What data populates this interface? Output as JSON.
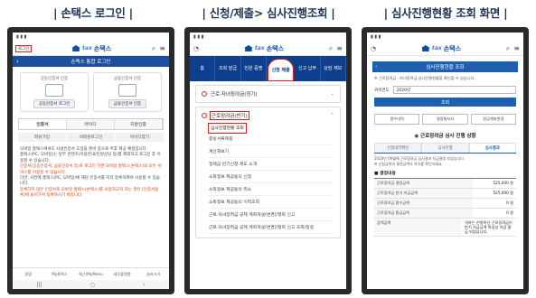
{
  "captions": {
    "c1": "손택스 로그인",
    "c2": "신청/제출> 심사진행조회",
    "c3": "심사진행현황 조회 화면"
  },
  "brand": {
    "logo_main": "손택스",
    "logo_prefix": "Hom",
    "logo_suffix": "tax"
  },
  "panel1": {
    "login_link": "로그인",
    "title": "손택스 통합 로그인",
    "cert_left_label": "공동인증서 인증",
    "cert_left_btn": "공동인증서 로그인",
    "cert_right_label": "금융인증서 인증",
    "cert_right_btn": "금융인증서 인증",
    "tabs": [
      "인증서",
      "아이디",
      "지문인증"
    ],
    "subtabs": [
      "회원가입",
      "비회원로그인",
      "아이디찾기"
    ],
    "notice": [
      "모바일 홈택스에서도 사설인증서 도입을 준비 중으로 추후 제공 예정입니다.",
      "홈택스(PC, 모바일)는 일부 콘텐츠(이용안내/민원상담 등)를 제외하고 로그인 후 이용할 수 있습니다.",
      "인증서(공동인증서, 금융인증서 등)로 로그인 하면 모바일 홈택스(손택스)의 모든 서비스를 이용할 수 있습니다.",
      "다만, 사전에 홈택스(PC, 모바일)에 해당 인증서를 미리 등록하여야 사용할 수 있습니다.",
      "등록하지 않은 인증서로 모바일 홈택스(손택스)를 사용하고자 하는 경우 [인증서등록]에 들어가서 등록하시기 바랍니다."
    ],
    "bottom_nav": [
      "알림",
      "My홈택스",
      "최근/MyMenu",
      "세무플랫폼",
      "글자크기"
    ]
  },
  "panel2": {
    "menu": [
      "홈",
      "조회 발급",
      "민원 증명",
      "신청 제출",
      "신고 납부",
      "상담 제보"
    ],
    "acc1": "근로·자녀장려금(정기)",
    "acc2": "근로장려금(반기)",
    "acc2_items": [
      "심사진행현황 조회",
      "증빙서류제출",
      "계산해보기",
      "정례급 반기신청 제도 소개",
      "소득정보 제공동의 신청",
      "소득정보 제공동의 취소",
      "소득정보 제공동의 이력조회",
      "근로·자녀장려금 공제 계좌개설(변경)/철회 신고",
      "근로·자녀장려금 공제 계좌개설(변경)/철회 신고 조회/정정"
    ]
  },
  "panel3": {
    "title": "심사진행현황 조회",
    "note": "※ 근로장려금 · 자녀장려금 심사진행현황을 확인할 수 있습니다.",
    "form_label": "귀속연도",
    "form_value": "2020년",
    "search_btn": "조회",
    "buttons": [
      "환수내역",
      "결정통지서",
      "환급계좌변경"
    ],
    "status_title": "근로장려금 심사 진행 상황",
    "steps": [
      "신청내역확인",
      "심사진행",
      "심사결과"
    ],
    "desc": [
      "2020년 09월에 근로장려금 심사결과 지급결정 되었습니다.",
      "※ 신청금액과 결정금액의 차이를 확인하세요."
    ],
    "section": "결정내용",
    "table": [
      {
        "k": "근로장려금 결정금액",
        "v": "525,000 원"
      },
      {
        "k": "근로장려금 반기 지급금액",
        "v": "525,000 원"
      },
      {
        "k": "근로장려금 환수금액",
        "v": "0 원"
      },
      {
        "k": "근로장려금 환급금액",
        "v": "0 원"
      },
      {
        "k": "감액금액",
        "v": "귀하는 신청하신 근로장려금이 반기 지급금액 특성상 차감 환급 되었습니다."
      }
    ]
  }
}
